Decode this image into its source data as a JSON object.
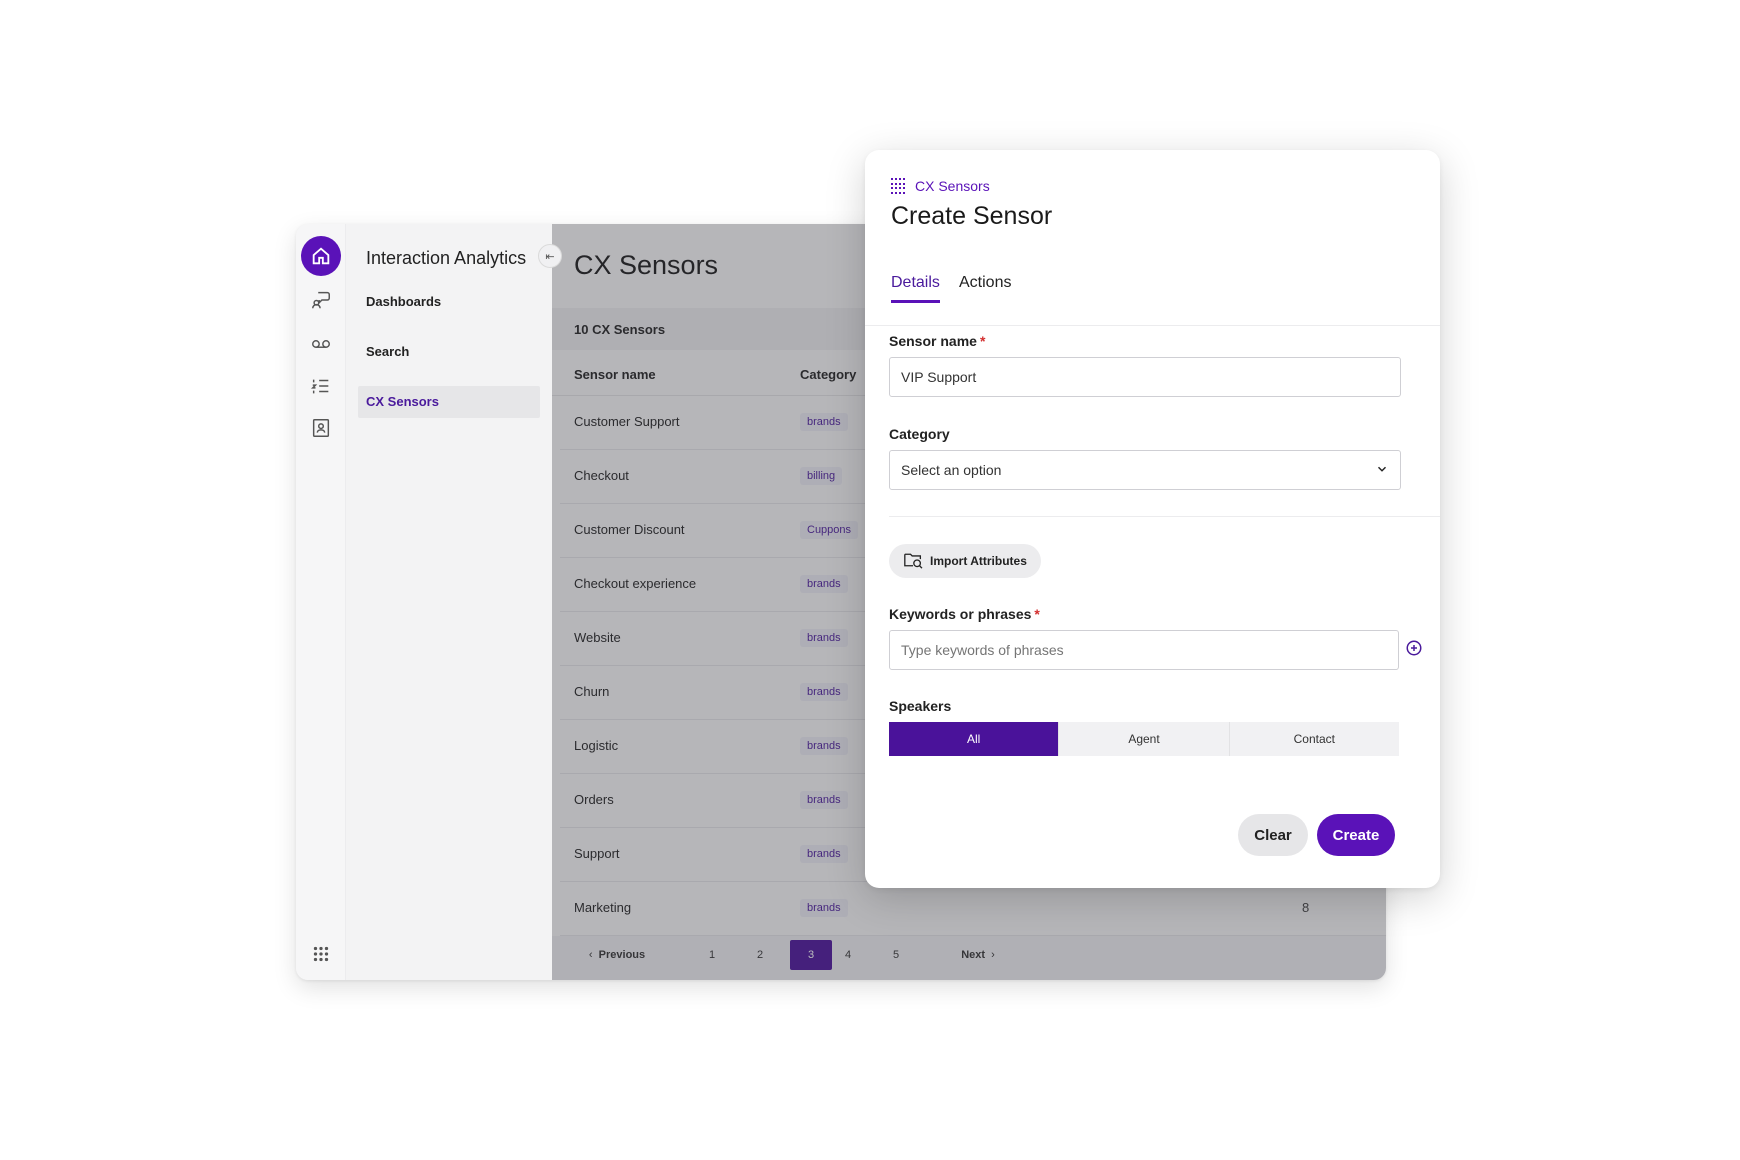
{
  "app": {
    "title": "Interaction Analytics",
    "nav": [
      {
        "label": "Dashboards"
      },
      {
        "label": "Search"
      },
      {
        "label": "CX Sensors",
        "active": true
      }
    ],
    "rail_icons": [
      "home-icon",
      "speech-analytics-icon",
      "voicemail-icon",
      "list-icon",
      "contact-card-icon",
      "apps-grid-icon"
    ]
  },
  "content": {
    "page_title": "CX Sensors",
    "count_label": "10 CX Sensors",
    "columns": [
      "Sensor name",
      "Category"
    ],
    "rows": [
      {
        "name": "Customer Support",
        "category": "brands"
      },
      {
        "name": "Checkout",
        "category": "billing"
      },
      {
        "name": "Customer Discount",
        "category": "Cuppons"
      },
      {
        "name": "Checkout experience",
        "category": "brands"
      },
      {
        "name": "Website",
        "category": "brands"
      },
      {
        "name": "Churn",
        "category": "brands"
      },
      {
        "name": "Logistic",
        "category": "brands"
      },
      {
        "name": "Orders",
        "category": "brands"
      },
      {
        "name": "Support",
        "category": "brands"
      },
      {
        "name": "Marketing",
        "category": "brands",
        "value": "8"
      }
    ],
    "pagination": {
      "previous": "Previous",
      "pages": [
        "1",
        "2",
        "3",
        "4",
        "5"
      ],
      "current": "3",
      "next": "Next"
    }
  },
  "dialog": {
    "breadcrumb": "CX Sensors",
    "title": "Create Sensor",
    "tabs": [
      "Details",
      "Actions"
    ],
    "active_tab": "Details",
    "sensor_name": {
      "label": "Sensor name",
      "required": "*",
      "value": "VIP Support"
    },
    "category": {
      "label": "Category",
      "value": "Select an option"
    },
    "import_label": "Import Attributes",
    "keywords": {
      "label": "Keywords or phrases",
      "required": "*",
      "placeholder": "Type keywords of phrases"
    },
    "speakers": {
      "label": "Speakers",
      "options": [
        "All",
        "Agent",
        "Contact"
      ],
      "selected": "All"
    },
    "clear_label": "Clear",
    "create_label": "Create"
  },
  "colors": {
    "accent": "#5a12b8",
    "accent_dark": "#4a129a",
    "required": "#d32f2f"
  }
}
